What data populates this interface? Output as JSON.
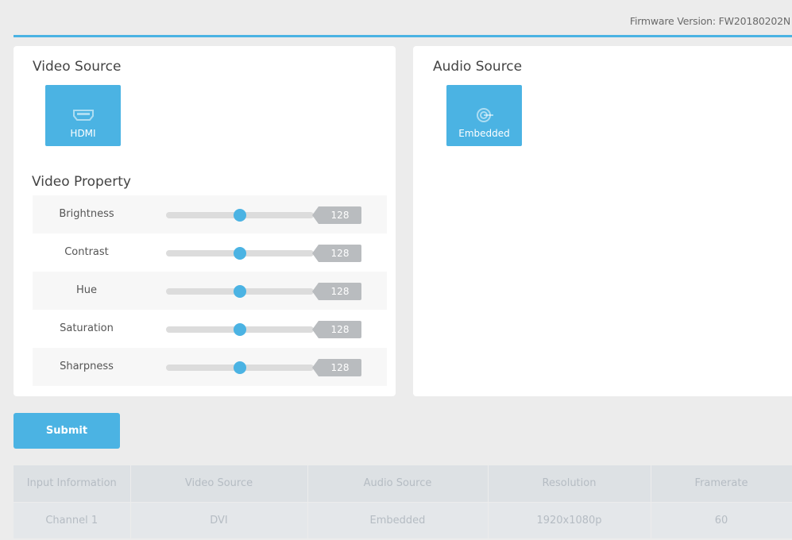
{
  "header": {
    "firmware_label": "Firmware Version: FW20180202N"
  },
  "video_source": {
    "title": "Video Source",
    "button": {
      "label": "HDMI",
      "icon": "hdmi-icon"
    }
  },
  "audio_source": {
    "title": "Audio Source",
    "button": {
      "label": "Embedded",
      "icon": "audio-source-icon"
    }
  },
  "video_property": {
    "title": "Video Property",
    "range": [
      0,
      255
    ],
    "items": [
      {
        "label": "Brightness",
        "value": "128"
      },
      {
        "label": "Contrast",
        "value": "128"
      },
      {
        "label": "Hue",
        "value": "128"
      },
      {
        "label": "Saturation",
        "value": "128"
      },
      {
        "label": "Sharpness",
        "value": "128"
      }
    ]
  },
  "actions": {
    "submit_label": "Submit"
  },
  "input_table": {
    "headers": [
      "Input Information",
      "Video Source",
      "Audio Source",
      "Resolution",
      "Framerate"
    ],
    "rows": [
      [
        "Channel 1",
        "DVI",
        "Embedded",
        "1920x1080p",
        "60"
      ]
    ]
  },
  "colors": {
    "accent": "#4bb3e3",
    "badge": "#b9bcbf",
    "track": "#dcdcdc"
  }
}
